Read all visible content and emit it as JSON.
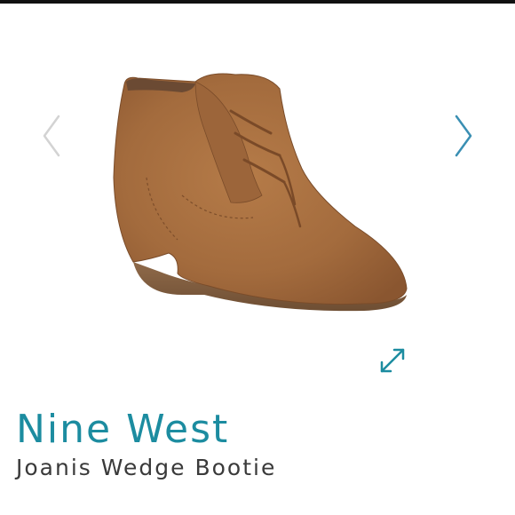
{
  "product": {
    "brand": "Nine West",
    "name": "Joanis Wedge Bootie"
  },
  "icons": {
    "prev": "chevron-left-icon",
    "next": "chevron-right-icon",
    "expand": "expand-icon"
  },
  "colors": {
    "accent": "#1c8ca0",
    "arrow_inactive": "#d3d3d3",
    "arrow_active": "#3a8fb3",
    "suede": "#a36b3d"
  }
}
